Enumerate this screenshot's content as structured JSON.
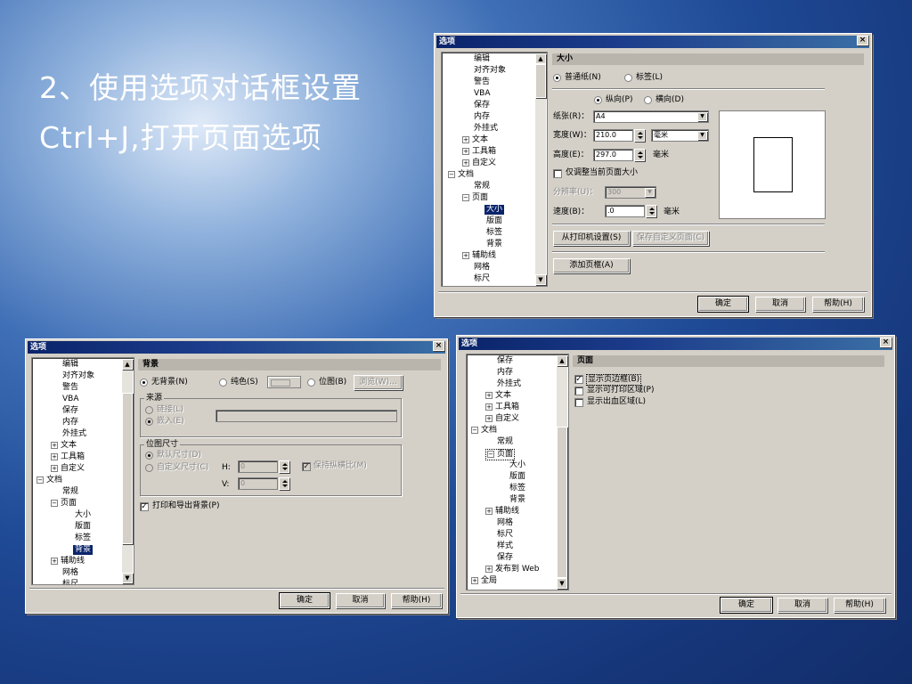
{
  "slide": {
    "line1": "2、使用选项对话框设置",
    "line2": "Ctrl+J,打开页面选项"
  },
  "common": {
    "dialog_title": "选项",
    "close_glyph": "×",
    "ok": "确定",
    "cancel": "取消",
    "help": "帮助(H)"
  },
  "dialog_size": {
    "tree": [
      "编辑",
      "对齐对象",
      "警告",
      "VBA",
      "保存",
      "内存",
      "外挂式",
      "文本",
      "工具箱",
      "自定义",
      "文档",
      "常规",
      "页面",
      "大小",
      "版面",
      "标签",
      "背景",
      "辅助线",
      "网格",
      "标尺"
    ],
    "section_header": "大小",
    "radio_plain_paper": "普通纸(N)",
    "radio_label": "标签(L)",
    "radio_portrait": "纵向(P)",
    "radio_landscape": "横向(D)",
    "paper_label": "纸张(R)：",
    "paper_value": "A4",
    "width_label": "宽度(W)：",
    "width_value": "210.0",
    "width_unit": "毫米",
    "height_label": "高度(E)：",
    "height_value": "297.0",
    "height_unit": "毫米",
    "only_current_page": "仅调整当前页面大小",
    "resolution_label": "分辨率(U)：",
    "resolution_value": "300",
    "bleed_label": "速度(B)：",
    "bleed_value": ".0",
    "bleed_unit": "毫米",
    "from_printer_btn": "从打印机设置(S)",
    "save_custom_btn": "保存自定义页面(C)",
    "add_frame_btn": "添加页框(A)"
  },
  "dialog_background": {
    "tree": [
      "编辑",
      "对齐对象",
      "警告",
      "VBA",
      "保存",
      "内存",
      "外挂式",
      "文本",
      "工具箱",
      "自定义",
      "文档",
      "常规",
      "页面",
      "大小",
      "版面",
      "标签",
      "背景",
      "辅助线",
      "网格",
      "标尺"
    ],
    "section_header": "背景",
    "radio_none": "无背景(N)",
    "radio_solid": "纯色(S)",
    "radio_bitmap": "位图(B)",
    "browse_btn": "浏览(W)...",
    "source_group": "来源",
    "radio_link": "链接(L)",
    "radio_embed": "嵌入(E)",
    "bitmap_size_group": "位图尺寸",
    "radio_default_size": "默认尺寸(D)",
    "radio_custom_size": "自定义尺寸(C)",
    "h_label": "H:",
    "h_value": "0",
    "v_label": "V:",
    "v_value": "0",
    "keep_ratio": "保持纵横比(M)",
    "print_export_bg": "打印和导出背景(P)"
  },
  "dialog_page": {
    "tree": [
      "保存",
      "内存",
      "外挂式",
      "文本",
      "工具箱",
      "自定义",
      "文档",
      "常规",
      "页面",
      "大小",
      "版面",
      "标签",
      "背景",
      "辅助线",
      "网格",
      "标尺",
      "样式",
      "保存",
      "发布到 Web",
      "全局"
    ],
    "section_header": "页面",
    "show_page_border": "显示页边框(B)",
    "show_printable_area": "显示可打印区域(P)",
    "show_bleed_area": "显示出血区域(L)"
  }
}
